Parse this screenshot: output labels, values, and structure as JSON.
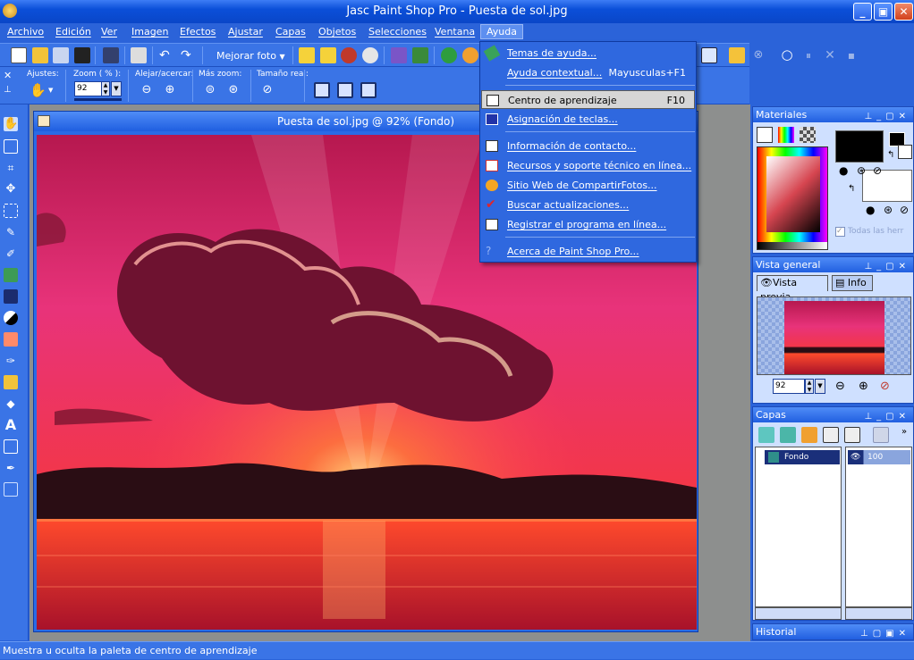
{
  "window": {
    "title": "Jasc Paint Shop Pro - Puesta de sol.jpg"
  },
  "menubar": [
    "Archivo",
    "Edición",
    "Ver",
    "Imagen",
    "Efectos",
    "Ajustar",
    "Capas",
    "Objetos",
    "Selecciones",
    "Ventana",
    "Ayuda"
  ],
  "toolbar": {
    "enhance_label": "Mejorar foto"
  },
  "options": {
    "presets_label": "Ajustes:",
    "zoom_label": "Zoom ( % ):",
    "zoom_value": "92",
    "zoom_inout_label": "Alejar/acercar:",
    "more_zoom_label": "Más zoom:",
    "actual_size_label": "Tamaño real:"
  },
  "image_window": {
    "title": "Puesta de sol.jpg @  92% (Fondo)"
  },
  "help_menu": {
    "items": [
      {
        "label": "Temas de ayuda...",
        "shortcut": ""
      },
      {
        "label": "Ayuda contextual...",
        "shortcut": "Mayusculas+F1"
      },
      {
        "label": "Centro de aprendizaje",
        "shortcut": "F10"
      },
      {
        "label": "Asignación de teclas...",
        "shortcut": ""
      },
      {
        "label": "Información de contacto...",
        "shortcut": ""
      },
      {
        "label": "Recursos y soporte técnico en línea...",
        "shortcut": ""
      },
      {
        "label": "Sitio Web de CompartirFotos...",
        "shortcut": ""
      },
      {
        "label": "Buscar actualizaciones...",
        "shortcut": ""
      },
      {
        "label": "Registrar el programa en línea...",
        "shortcut": ""
      },
      {
        "label": "Acerca de Paint Shop Pro...",
        "shortcut": ""
      }
    ]
  },
  "palettes": {
    "materials": {
      "title": "Materiales",
      "all_tools_label": "Todas las herr"
    },
    "overview": {
      "title": "Vista general",
      "tab_preview": "Vista previa",
      "tab_info": "Info",
      "zoom_value": "92"
    },
    "layers": {
      "title": "Capas",
      "layer_name": "Fondo",
      "opacity": "100"
    },
    "history": {
      "title": "Historial"
    }
  },
  "status": {
    "text": "Muestra u oculta la paleta de centro de aprendizaje"
  },
  "colors": {
    "accent": "#2b63d9",
    "foreground": "#000000",
    "background": "#ffffff"
  }
}
